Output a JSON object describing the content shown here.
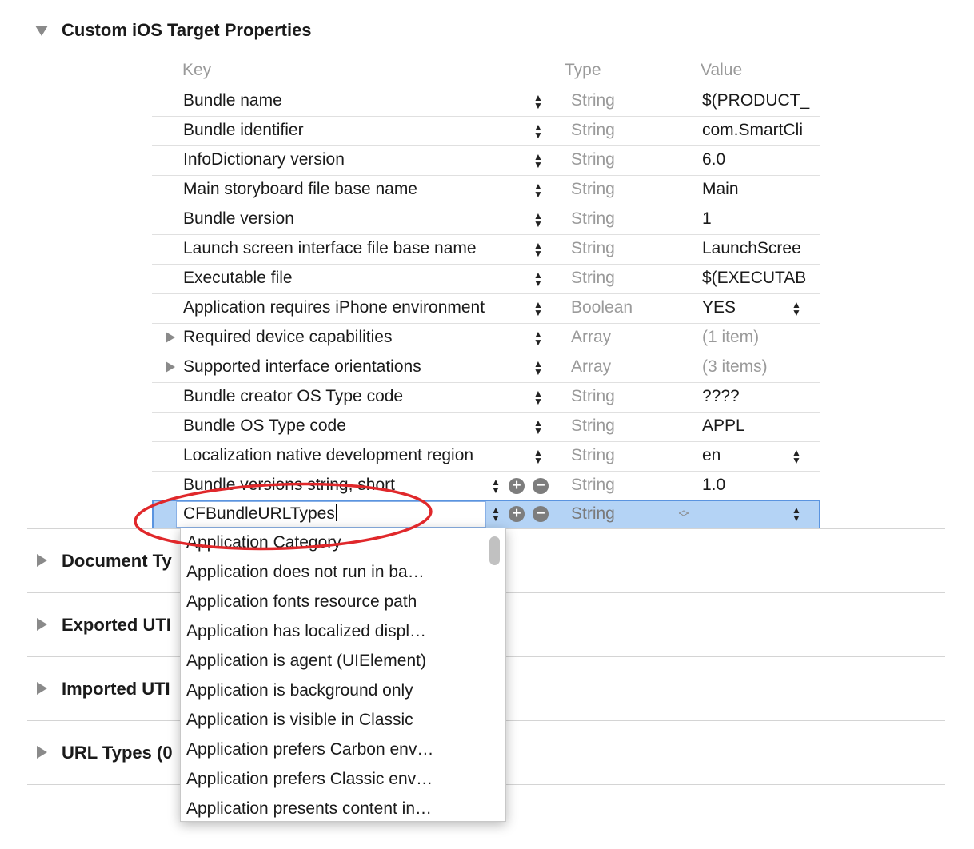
{
  "sections": {
    "custom_title": "Custom iOS Target Properties",
    "document_types": "Document Ty",
    "exported_utis": "Exported UTI",
    "imported_utis": "Imported UTI",
    "url_types": "URL Types (0"
  },
  "table": {
    "headers": {
      "key": "Key",
      "type": "Type",
      "value": "Value"
    },
    "rows": [
      {
        "key": "Bundle name",
        "type": "String",
        "value": "$(PRODUCT_"
      },
      {
        "key": "Bundle identifier",
        "type": "String",
        "value": "com.SmartCli"
      },
      {
        "key": "InfoDictionary version",
        "type": "String",
        "value": "6.0"
      },
      {
        "key": "Main storyboard file base name",
        "type": "String",
        "value": "Main"
      },
      {
        "key": "Bundle version",
        "type": "String",
        "value": "1"
      },
      {
        "key": "Launch screen interface file base name",
        "type": "String",
        "value": "LaunchScree"
      },
      {
        "key": "Executable file",
        "type": "String",
        "value": "$(EXECUTAB"
      },
      {
        "key": "Application requires iPhone environment",
        "type": "Boolean",
        "value": "YES"
      },
      {
        "key": "Required device capabilities",
        "type": "Array",
        "value": "(1 item)"
      },
      {
        "key": "Supported interface orientations",
        "type": "Array",
        "value": "(3 items)"
      },
      {
        "key": "Bundle creator OS Type code",
        "type": "String",
        "value": "????"
      },
      {
        "key": "Bundle OS Type code",
        "type": "String",
        "value": "APPL"
      },
      {
        "key": "Localization native development region",
        "type": "String",
        "value": "en"
      },
      {
        "key": "Bundle versions string, short",
        "type": "String",
        "value": "1.0"
      }
    ],
    "editing_row": {
      "key_value": "CFBundleURLTypes",
      "type": "String"
    }
  },
  "autocomplete": [
    "Application Category",
    "Application does not run in ba…",
    "Application fonts resource path",
    "Application has localized displ…",
    "Application is agent (UIElement)",
    "Application is background only",
    "Application is visible in Classic",
    "Application prefers Carbon env…",
    "Application prefers Classic env…",
    "Application presents content in…"
  ],
  "icons": {
    "disclosure": "disclosure-triangle-icon",
    "stepper": "up-down-stepper-icon",
    "add": "add-circle-icon",
    "remove": "remove-circle-icon"
  },
  "colors": {
    "selection": "#b4d3f5",
    "annotation": "#e0282b"
  }
}
